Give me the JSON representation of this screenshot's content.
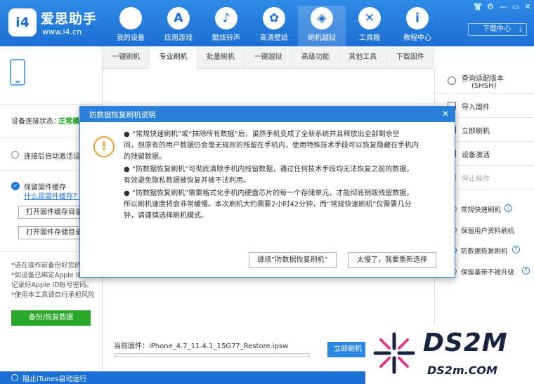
{
  "header": {
    "brand": "爱思助手",
    "url": "www.i4.cn",
    "logo_text": "i4",
    "nav": [
      {
        "label": "我的设备",
        "icon": "apple-icon",
        "glyph": ""
      },
      {
        "label": "应用游戏",
        "icon": "app-store-icon",
        "glyph": "A"
      },
      {
        "label": "酷炫铃声",
        "icon": "bell-icon",
        "glyph": "♪"
      },
      {
        "label": "高清壁纸",
        "icon": "flower-icon",
        "glyph": "✿"
      },
      {
        "label": "刷机越狱",
        "icon": "dropbox-icon",
        "glyph": "◈"
      },
      {
        "label": "工具箱",
        "icon": "tools-icon",
        "glyph": "✕"
      },
      {
        "label": "教程中心",
        "icon": "info-icon",
        "glyph": "i"
      }
    ],
    "download_center": "下载中心"
  },
  "tabs": [
    "一键刷机",
    "专业刷机",
    "批量刷机",
    "一键越狱",
    "高级功能",
    "其他工具",
    "下载固件"
  ],
  "sidebar": {
    "conn_label": "设备连接状态：",
    "conn_status": "正常模",
    "auto_activate": "连接后自动激活设备",
    "keep_cache": "保留固件缓存",
    "what_is_cache": "什么是固件缓存？",
    "open_cache_dir": "打开固件缓存目录",
    "open_store_dir": "打开固件存储目录",
    "notes": [
      "*请在操作前备份好您的",
      "*如设备已绑定Apple ID",
      " 记录好Apple ID帐号密码。",
      "*使用本工具请自行承担风险"
    ],
    "backup_button": "备份/恢复数据"
  },
  "right": {
    "items": [
      {
        "label": "查询适配版本",
        "sub": "(SHSH)"
      },
      {
        "label": "导入固件"
      },
      {
        "label": "立即刷机"
      },
      {
        "label": "设备激活"
      },
      {
        "label": "停止操作"
      }
    ],
    "options": [
      "常规快速刷机",
      "保留用户资料刷机",
      "防数据恢复刷机",
      "保留基带不被升级"
    ]
  },
  "main": {
    "firmware_label": "当前固件：",
    "firmware_value": "iPhone_4.7_11.4.1_15G77_Restore.ipsw",
    "flash_button": "立即刷机"
  },
  "status": {
    "block_itunes": "阻止iTunes自动运行"
  },
  "modal": {
    "title": "防数据恢复刷机说明",
    "lines": [
      "●  “常规快速刷机”或“抹除所有数据”后，虽然手机变成了全新系统并且释放出全部剩余空",
      "间，但原有的用户数据仍会毫无规则的残留在手机内，使用特殊技术手段可以恢复隐藏在手机内",
      "的残留数据。",
      "●  “防数据恢复刷机”可彻底清除手机内残留数据，通过任何技术手段均无法恢复之前的数据，",
      "有效避免隐私数据被恢复并被不法利用。",
      "●  “防数据恢复刷机”需要格式化手机内硬盘芯片的每一个存储单元，才能彻底销毁残留数据，",
      "所以刷机速度将会非常缓慢。本次刷机大约需要2小时42分钟，而“常规快速刷机”仅需要几分",
      "钟，请谨慎选择刷机模式。"
    ],
    "continue_button": "继续“防数据恢复刷机”",
    "reselect_button": "太慢了，我要重新选择"
  },
  "watermark": {
    "big": "DS2M",
    "small": "DS2m.COM"
  }
}
